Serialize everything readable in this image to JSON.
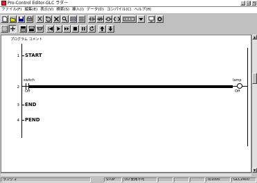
{
  "window": {
    "title": "Pro-Control Editor-GLC ラダー",
    "controls": [
      "_",
      "□",
      "×"
    ]
  },
  "menu": [
    "ファイル(F)",
    "編集(E)",
    "表示(V)",
    "検索(S)",
    "挿入(I)",
    "データ(D)",
    "コンパイル(C)",
    "ヘルプ(H)"
  ],
  "toolbar1": {
    "icons": [
      "new-icon",
      "open-icon",
      "save-icon",
      "print-icon",
      "cut-icon",
      "undo-icon",
      "delete-icon",
      "find-icon",
      "replace-icon",
      "properties-icon",
      "contact-no-icon",
      "contact-nc-icon",
      "coil-icon",
      "coil-set-icon",
      "timer-icon",
      "dropdown-icon",
      "monitor-icon",
      "online-icon"
    ]
  },
  "toolbar2": {
    "icons": [
      "select-icon",
      "zoom-icon",
      "rung-insert-icon",
      "rung-below-icon",
      "branch-icon",
      "first-icon",
      "play-icon",
      "fast-forward-icon",
      "stop-icon",
      "pause-icon",
      "refresh-icon",
      "up-arrow-icon",
      "down-arrow-icon"
    ]
  },
  "editor": {
    "comment": "プログラム コメント",
    "rungs": [
      {
        "num": "1",
        "text": "START"
      },
      {
        "num": "2",
        "text": ""
      },
      {
        "num": "3",
        "text": "END"
      },
      {
        "num": "4",
        "text": "PEND"
      }
    ],
    "contact": {
      "name": "switch",
      "state": "Off"
    },
    "coil": {
      "name": "lamp",
      "state": "Off"
    }
  },
  "status": {
    "rung": "ランク 2",
    "mode": "STOP",
    "io": "I/O 使用不可",
    "cells": [
      "",
      "",
      ""
    ],
    "count": "0/1000",
    "model": "GLC2400"
  }
}
